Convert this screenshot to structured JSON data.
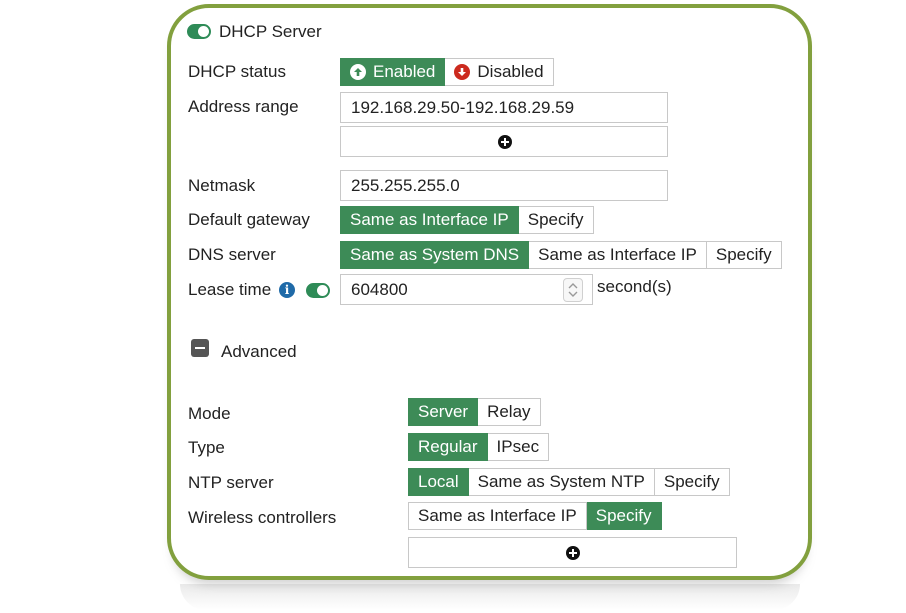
{
  "header": {
    "title": "DHCP Server"
  },
  "dhcp_status": {
    "label": "DHCP status",
    "options": [
      "Enabled",
      "Disabled"
    ]
  },
  "address_range": {
    "label": "Address range",
    "value": "192.168.29.50-192.168.29.59"
  },
  "netmask": {
    "label": "Netmask",
    "value": "255.255.255.0"
  },
  "default_gateway": {
    "label": "Default gateway",
    "options": [
      "Same as Interface IP",
      "Specify"
    ]
  },
  "dns_server": {
    "label": "DNS server",
    "options": [
      "Same as System DNS",
      "Same as Interface IP",
      "Specify"
    ]
  },
  "lease_time": {
    "label": "Lease time",
    "value": "604800",
    "unit": "second(s)"
  },
  "advanced": {
    "label": "Advanced"
  },
  "mode": {
    "label": "Mode",
    "options": [
      "Server",
      "Relay"
    ]
  },
  "type": {
    "label": "Type",
    "options": [
      "Regular",
      "IPsec"
    ]
  },
  "ntp_server": {
    "label": "NTP server",
    "options": [
      "Local",
      "Same as System NTP",
      "Specify"
    ]
  },
  "wireless_controllers": {
    "label": "Wireless controllers",
    "options": [
      "Same as Interface IP",
      "Specify"
    ]
  },
  "colors": {
    "accent": "#3d8b57",
    "frame": "#82a03e",
    "enabled_icon": "#3d8b57",
    "disabled_icon": "#cc2a1e",
    "info": "#1f6aa8"
  },
  "icons": {
    "enabled": "arrow-up-circle-icon",
    "disabled": "arrow-down-circle-icon",
    "add": "plus-circle-icon",
    "info": "info-icon",
    "collapse": "minus-square-icon"
  }
}
